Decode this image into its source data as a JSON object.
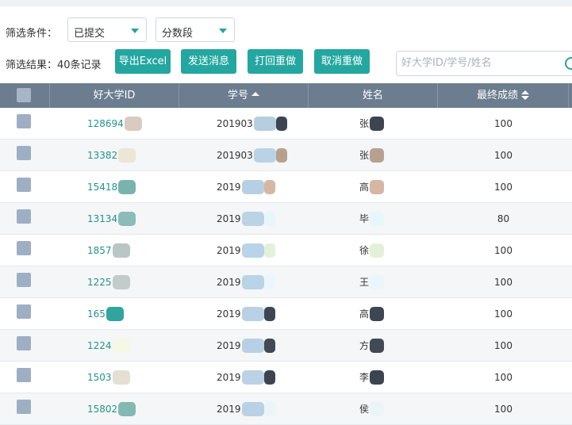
{
  "filter": {
    "label": "筛选条件：",
    "status_value": "已提交",
    "range_value": "分数段"
  },
  "actions": {
    "result_label": "筛选结果：40条记录",
    "export_label": "导出Excel",
    "send_label": "发送消息",
    "redo_label": "打回重做",
    "cancel_redo_label": "取消重做",
    "search_placeholder": "好大学ID/学号/姓名"
  },
  "table": {
    "columns": [
      "",
      "好大学ID",
      "学号",
      "姓名",
      "最终成绩"
    ],
    "rows": [
      {
        "id": "128694",
        "student_no": "201903",
        "name": "张",
        "score": "100",
        "c1": "#d9cbc0",
        "c2": "#b7cde0",
        "c3": "#3d4552"
      },
      {
        "id": "13382",
        "student_no": "201903",
        "name": "张",
        "score": "100",
        "c1": "#ece6d6",
        "c2": "#b9d3e6",
        "c3": "#b8a08f"
      },
      {
        "id": "15418",
        "student_no": "2019",
        "name": "高",
        "score": "100",
        "c1": "#7ab3ae",
        "c2": "#b6cfe3",
        "c3": "#d6b7a3"
      },
      {
        "id": "13134",
        "student_no": "2019",
        "name": "毕",
        "score": "80",
        "c1": "#8cbcb7",
        "c2": "#bcd3e5",
        "c3": "#e7f7f9"
      },
      {
        "id": "1857",
        "student_no": "2019",
        "name": "徐",
        "score": "100",
        "c1": "#b9c7c4",
        "c2": "#b9d4e6",
        "c3": "#e3f1d9"
      },
      {
        "id": "1225",
        "student_no": "2019",
        "name": "王",
        "score": "100",
        "c1": "#c2ccc9",
        "c2": "#b9d3e7",
        "c3": "#eaf6fa"
      },
      {
        "id": "165",
        "student_no": "2019",
        "name": "高",
        "score": "100",
        "c1": "#31a49e",
        "c2": "#b8d1e4",
        "c3": "#3f4653"
      },
      {
        "id": "1224",
        "student_no": "2019",
        "name": "方",
        "score": "100",
        "c1": "#f6f7e4",
        "c2": "#b7d0e5",
        "c3": "#414955"
      },
      {
        "id": "1503",
        "student_no": "2019",
        "name": "李",
        "score": "100",
        "c1": "#e4dfd1",
        "c2": "#bad2e4",
        "c3": "#3c4452"
      },
      {
        "id": "15802",
        "student_no": "2019",
        "name": "侯",
        "score": "100",
        "c1": "#84b8b2",
        "c2": "#b9d1e4",
        "c3": "#eaf5f7"
      }
    ]
  },
  "colors": {
    "accent": "#24a7a0",
    "header_bg": "#6b7d8f",
    "link": "#24928c"
  }
}
